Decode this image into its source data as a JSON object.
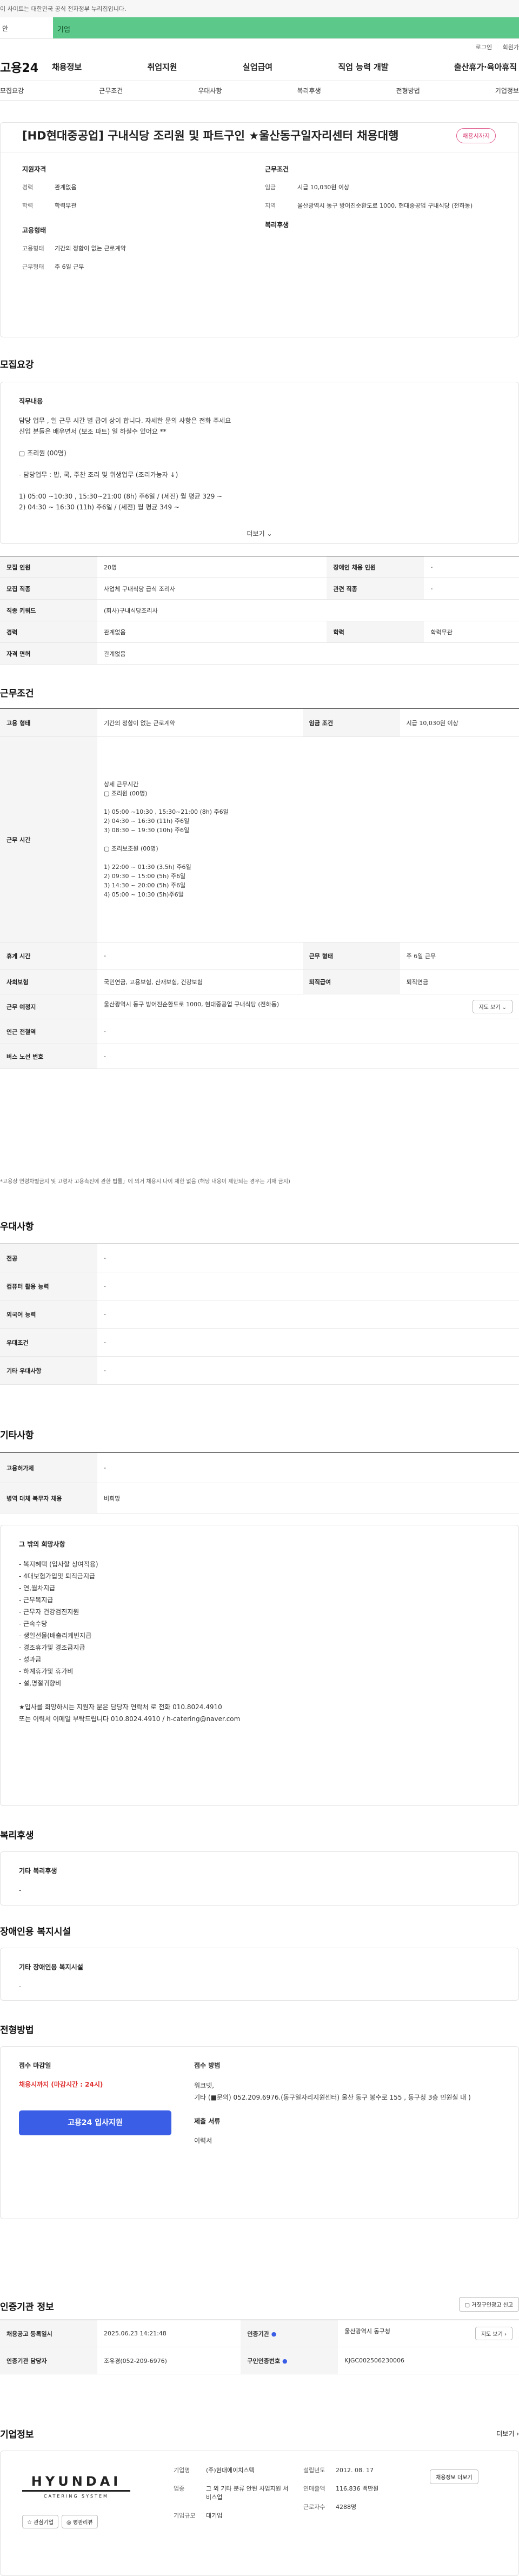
{
  "gov_notice": "이 사이트는 대한민국 공식 전자정부 누리집입니다.",
  "banner": {
    "label": "안",
    "text": "기업"
  },
  "util": [
    "로그인",
    "회원가"
  ],
  "logo": "고용24",
  "gnb": [
    "채용정보",
    "취업지원",
    "실업급여",
    "직업 능력 개발",
    "출산휴가·육아휴직"
  ],
  "subnav": [
    "모집요강",
    "근무조건",
    "우대사항",
    "복리후생",
    "전형방법",
    "기업정보"
  ],
  "job": {
    "title": "[HD현대중공업] 구내식당 조리원 및 파트구인 ★울산동구일자리센터 채용대행",
    "badge": "채용시까지",
    "qual_title": "지원자격",
    "qual": [
      {
        "k": "경력",
        "v": "관계없음"
      },
      {
        "k": "학력",
        "v": "학력무관"
      }
    ],
    "emp_title": "고용형태",
    "emp": [
      {
        "k": "고용형태",
        "v": "기간의 정함이 없는 근로계약"
      },
      {
        "k": "근무형태",
        "v": "주 6일 근무"
      }
    ],
    "cond_title": "근무조건",
    "cond": [
      {
        "k": "임금",
        "v": "시급 10,030원 이상"
      },
      {
        "k": "지역",
        "v": "울산광역시 동구 방어진순환도로 1000, 현대중공업 구내식당 (전하동)"
      }
    ],
    "welfare_title": "복리후생"
  },
  "recruit": {
    "section": "모집요강",
    "duty_title": "직무내용",
    "duty_text": "담당 업무 , 일 근무 시간 별 급여 상이 합니다. 자세한 문의 사항은 전화 주세요\n신입 분들은 배우면서 (보조 파트) 일 하실수 있어요 **\n\n▢ 조리원 (00명)\n\n- 담당업무 : 밥, 국, 주찬 조리 및 위생업무 (조리가능자 ↓)\n\n1) 05:00 ~10:30 , 15:30~21:00 (8h) 주6일 / (세전) 월 평균 329 ~\n2) 04:30 ~ 16:30 (11h) 주6일 / (세전) 월 평균 349 ~",
    "more": "더보기",
    "rows": [
      [
        {
          "th": "모집 인원"
        },
        {
          "td": "20명"
        },
        {
          "th": "장애인 채용 인원"
        },
        {
          "td": "-"
        }
      ],
      [
        {
          "th": "모집 직종"
        },
        {
          "td": "사업체 구내식당 급식 조리사"
        },
        {
          "th": "관련 직종"
        },
        {
          "td": "-"
        }
      ],
      [
        {
          "th": "직종 키워드"
        },
        {
          "td": "(회사)구내식당조리사",
          "span": 3
        }
      ],
      [
        {
          "th": "경력"
        },
        {
          "td": "관계없음"
        },
        {
          "th": "학력"
        },
        {
          "td": "학력무관"
        }
      ],
      [
        {
          "th": "자격 면허"
        },
        {
          "td": "관계없음",
          "span": 3
        }
      ]
    ]
  },
  "work": {
    "section": "근무조건",
    "type_label": "고용 형태",
    "type_value": "기간의 정함이 없는 근로계약",
    "wage_label": "임금 조건",
    "wage_value": "시급 10,030원 이상",
    "hours_label": "근무 시간",
    "hours_text": "상세 근무시간\n▢ 조리원 (00명)\n\n1) 05:00 ~10:30 , 15:30~21:00 (8h) 주6일\n2) 04:30 ~ 16:30 (11h) 주6일\n3) 08:30 ~ 19:30 (10h) 주6일\n\n▢ 조리보조원 (00명)\n\n1) 22:00 ~ 01:30 (3.5h) 주6일\n2) 09:30 ~ 15:00 (5h) 주6일\n3) 14:30 ~ 20:00 (5h) 주6일\n4) 05:00 ~ 10:30 (5h)주6일",
    "rest_label": "휴게 시간",
    "rest_value": "-",
    "form_label": "근무 형태",
    "form_value": "주 6일 근무",
    "ins_label": "사회보험",
    "ins_value": "국민연금, 고용보험, 산재보험, 건강보험",
    "ret_label": "퇴직급여",
    "ret_value": "퇴직연금",
    "place_label": "근무 예정지",
    "place_value": "울산광역시 동구 방어진순환도로 1000, 현대중공업 구내식당 (전하동)",
    "map_btn": "지도 보기",
    "subway_label": "인근 전철역",
    "subway_value": "-",
    "bus_label": "버스 노선 번호",
    "bus_value": "-",
    "note": "*고용상 연령차별금지 및 고령자 고용촉진에 관한 법률」에 의거 채용시 나이 제한 없음 (해당 내용이 제한되는 경우는 기재 금지)"
  },
  "pref": {
    "section": "우대사항",
    "rows": [
      {
        "k": "전공",
        "v": "-"
      },
      {
        "k": "컴퓨터 활용 능력",
        "v": "-"
      },
      {
        "k": "외국어 능력",
        "v": "-"
      },
      {
        "k": "우대조건",
        "v": "-"
      },
      {
        "k": "기타 우대사항",
        "v": "-"
      }
    ]
  },
  "etc": {
    "section": "기타사항",
    "rows": [
      {
        "k": "고용허가제",
        "v": "-"
      },
      {
        "k": "병역 대체 복무자 채용",
        "v": "비희망"
      }
    ],
    "wish_title": "그 밖의 희망사항",
    "wish_text": "- 복지혜택 (입사할 상여적용)\n- 4대보험가입및 퇴직금지급\n- 연,월차지급\n- 근무복지급\n- 근무자 건강검진지원\n- 근속수당\n- 생일선물(배출리케빈지급\n- 경조휴가및 경조금지급\n- 성과금\n- 하계휴가및 휴가비\n- 설,명절귀향비\n\n★입사를 희망하시는 지원자 분은 담당자 연락처 로 전화 010.8024.4910\n또는 이력서 이메일 부탁드립니다 010.8024.4910 / h-catering@naver.com"
  },
  "welfare": {
    "section": "복리후생",
    "sub": "기타 복리후생",
    "val": "-"
  },
  "disab": {
    "section": "장애인용 복지시설",
    "sub": "기타 장애인용 복지시설",
    "val": "-"
  },
  "process": {
    "section": "전형방법",
    "deadline_title": "접수 마감일",
    "deadline": "채용시까지 (마감시간 : 24시)",
    "apply_btn": "고용24 입사지원",
    "method_title": "접수 방법",
    "method": "워크넷,\n기타 (■문의) 052.209.6976.(동구일자리지원센터)  울산 동구 봉수로 155 , 동구청 3층 민원실 내 )",
    "docs_title": "제출 서류",
    "docs": "이력서"
  },
  "cert": {
    "section": "인증기관 정보",
    "report_btn": "거짓구인광고 신고",
    "reg_label": "채용공고 등록일시",
    "reg_value": "2025.06.23 14:21:48",
    "org_label": "인증기관",
    "org_value": "울산광역시 동구청",
    "map_btn": "지도 보기",
    "mgr_label": "인증기관 담당자",
    "mgr_value": "조유경(052-209-6976)",
    "no_label": "구인인증번호",
    "no_value": "KJGC002506230006"
  },
  "company": {
    "section": "기업정보",
    "more": "더보기",
    "logo_main": "HYUNDAI",
    "logo_sub": "CATERING SYSTEM",
    "interest_btn": "관심기업",
    "review_btn": "평판리뷰",
    "name_label": "기업명",
    "name_value": "(주)현대에이치스텍",
    "ind_label": "업종",
    "ind_value": "그 외 기타 분류 안된 사업지원 서비스업",
    "size_label": "기업규모",
    "size_value": "대기업",
    "est_label": "설립년도",
    "est_value": "2012. 08. 17",
    "rev_label": "연매출액",
    "rev_value": "116,836 백만원",
    "emp_label": "근로자수",
    "emp_value": "4288명",
    "detail_btn": "채용정보 더보기"
  },
  "colors": {
    "accent": "#3b5ee6",
    "banner": "#5cc98a",
    "badge": "#d6336c"
  }
}
